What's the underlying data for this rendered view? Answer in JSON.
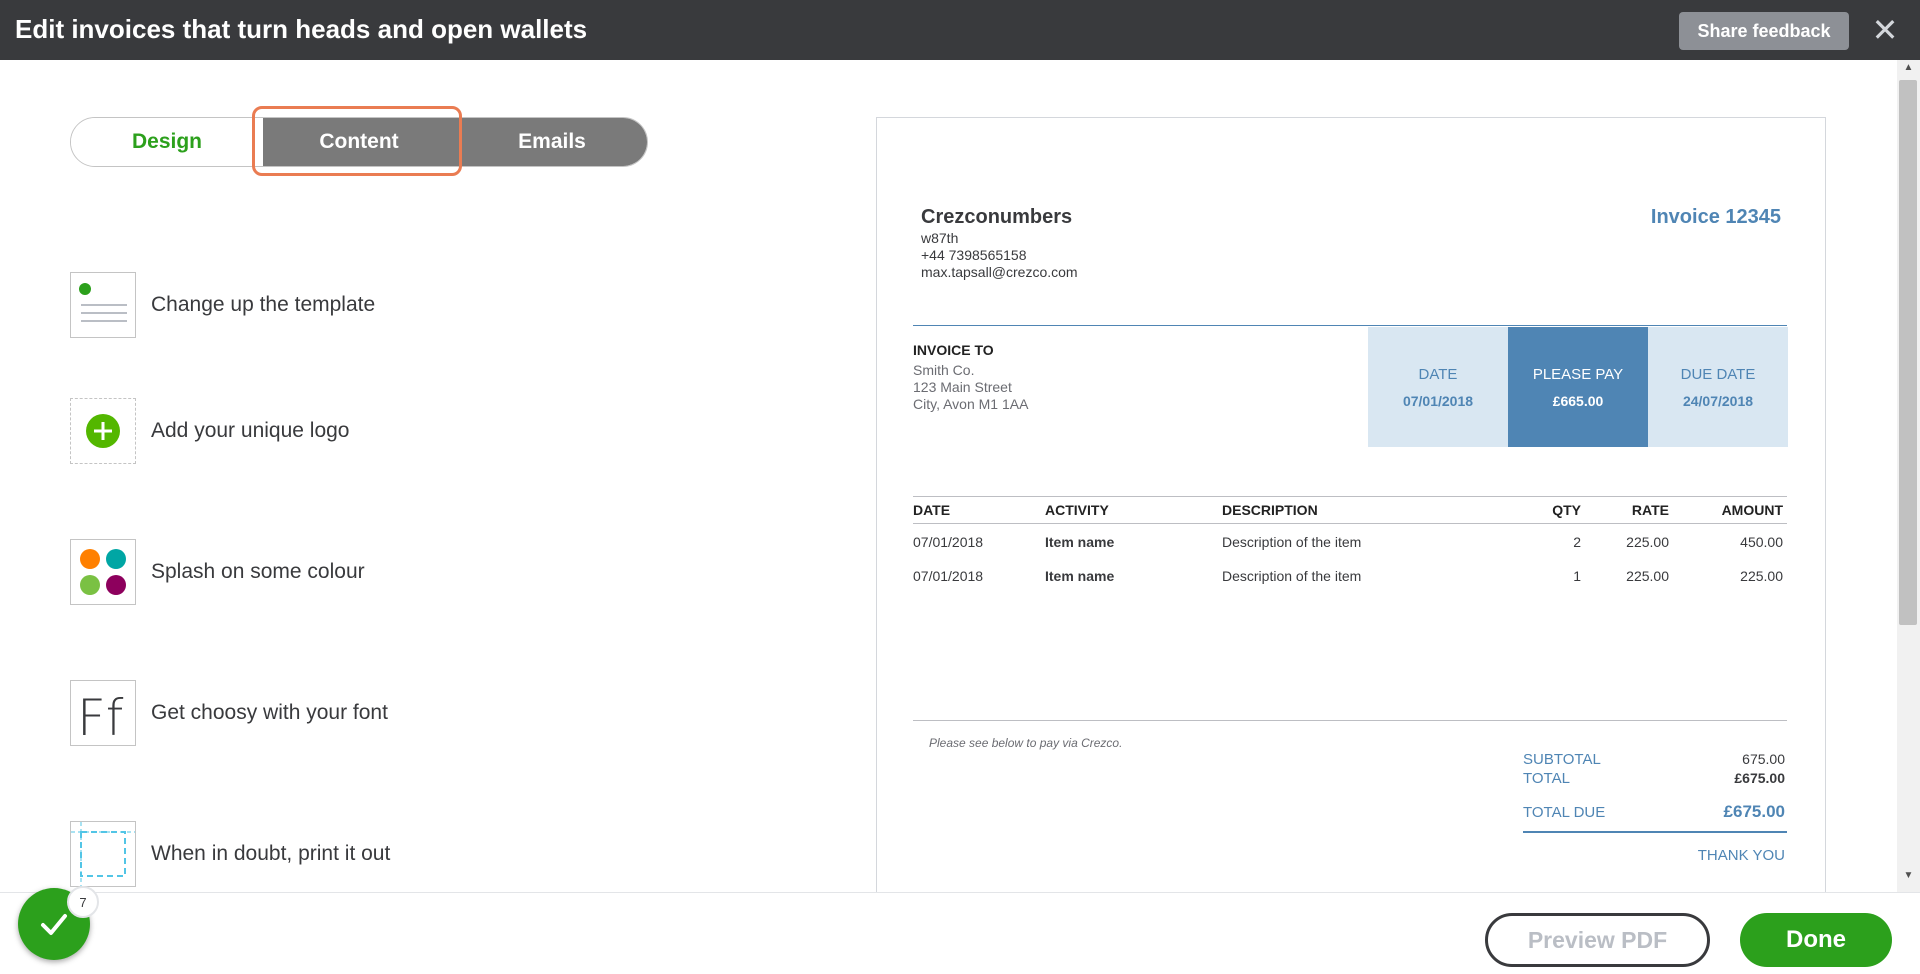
{
  "header": {
    "title": "Edit invoices that turn heads and open wallets",
    "share_label": "Share feedback",
    "close_icon": "close-icon"
  },
  "tabs": [
    {
      "label": "Design",
      "active": false
    },
    {
      "label": "Content",
      "active": true
    },
    {
      "label": "Emails",
      "active": false
    }
  ],
  "features": [
    {
      "label": "Change up the template",
      "icon": "template-icon"
    },
    {
      "label": "Add your unique logo",
      "icon": "add-logo-icon"
    },
    {
      "label": "Splash on some colour",
      "icon": "colour-palette-icon"
    },
    {
      "label": "Get choosy with your font",
      "icon": "font-icon"
    },
    {
      "label": "When in doubt, print it out",
      "icon": "print-icon"
    }
  ],
  "invoice": {
    "company": {
      "name": "Crezconumbers",
      "address": "w87th",
      "phone": "+44 7398565158",
      "email": "max.tapsall@crezco.com"
    },
    "title": "Invoice 12345",
    "bill_to": {
      "heading": "INVOICE TO",
      "name": "Smith Co.",
      "street": "123 Main Street",
      "city": "City, Avon M1 1AA"
    },
    "date_box": {
      "label": "DATE",
      "value": "07/01/2018"
    },
    "pay_box": {
      "label": "PLEASE PAY",
      "value": "£665.00"
    },
    "due_box": {
      "label": "DUE DATE",
      "value": "24/07/2018"
    },
    "columns": [
      "DATE",
      "ACTIVITY",
      "DESCRIPTION",
      "QTY",
      "RATE",
      "AMOUNT"
    ],
    "rows": [
      {
        "date": "07/01/2018",
        "activity": "Item name",
        "description": "Description of the item",
        "qty": "2",
        "rate": "225.00",
        "amount": "450.00"
      },
      {
        "date": "07/01/2018",
        "activity": "Item name",
        "description": "Description of the item",
        "qty": "1",
        "rate": "225.00",
        "amount": "225.00"
      }
    ],
    "note": "Please see below to pay via Crezco.",
    "subtotal_label": "SUBTOTAL",
    "subtotal_value": "675.00",
    "total_label": "TOTAL",
    "total_value": "£675.00",
    "total_due_label": "TOTAL DUE",
    "total_due_value": "£675.00",
    "thanks": "THANK YOU"
  },
  "footer": {
    "preview_label": "Preview PDF",
    "done_label": "Done",
    "tasks_badge": "7"
  },
  "colors": {
    "brand_green": "#2ca01c",
    "invoice_accent": "#4f85b4",
    "header_bg": "#393a3d",
    "highlight": "#ea7c52"
  }
}
